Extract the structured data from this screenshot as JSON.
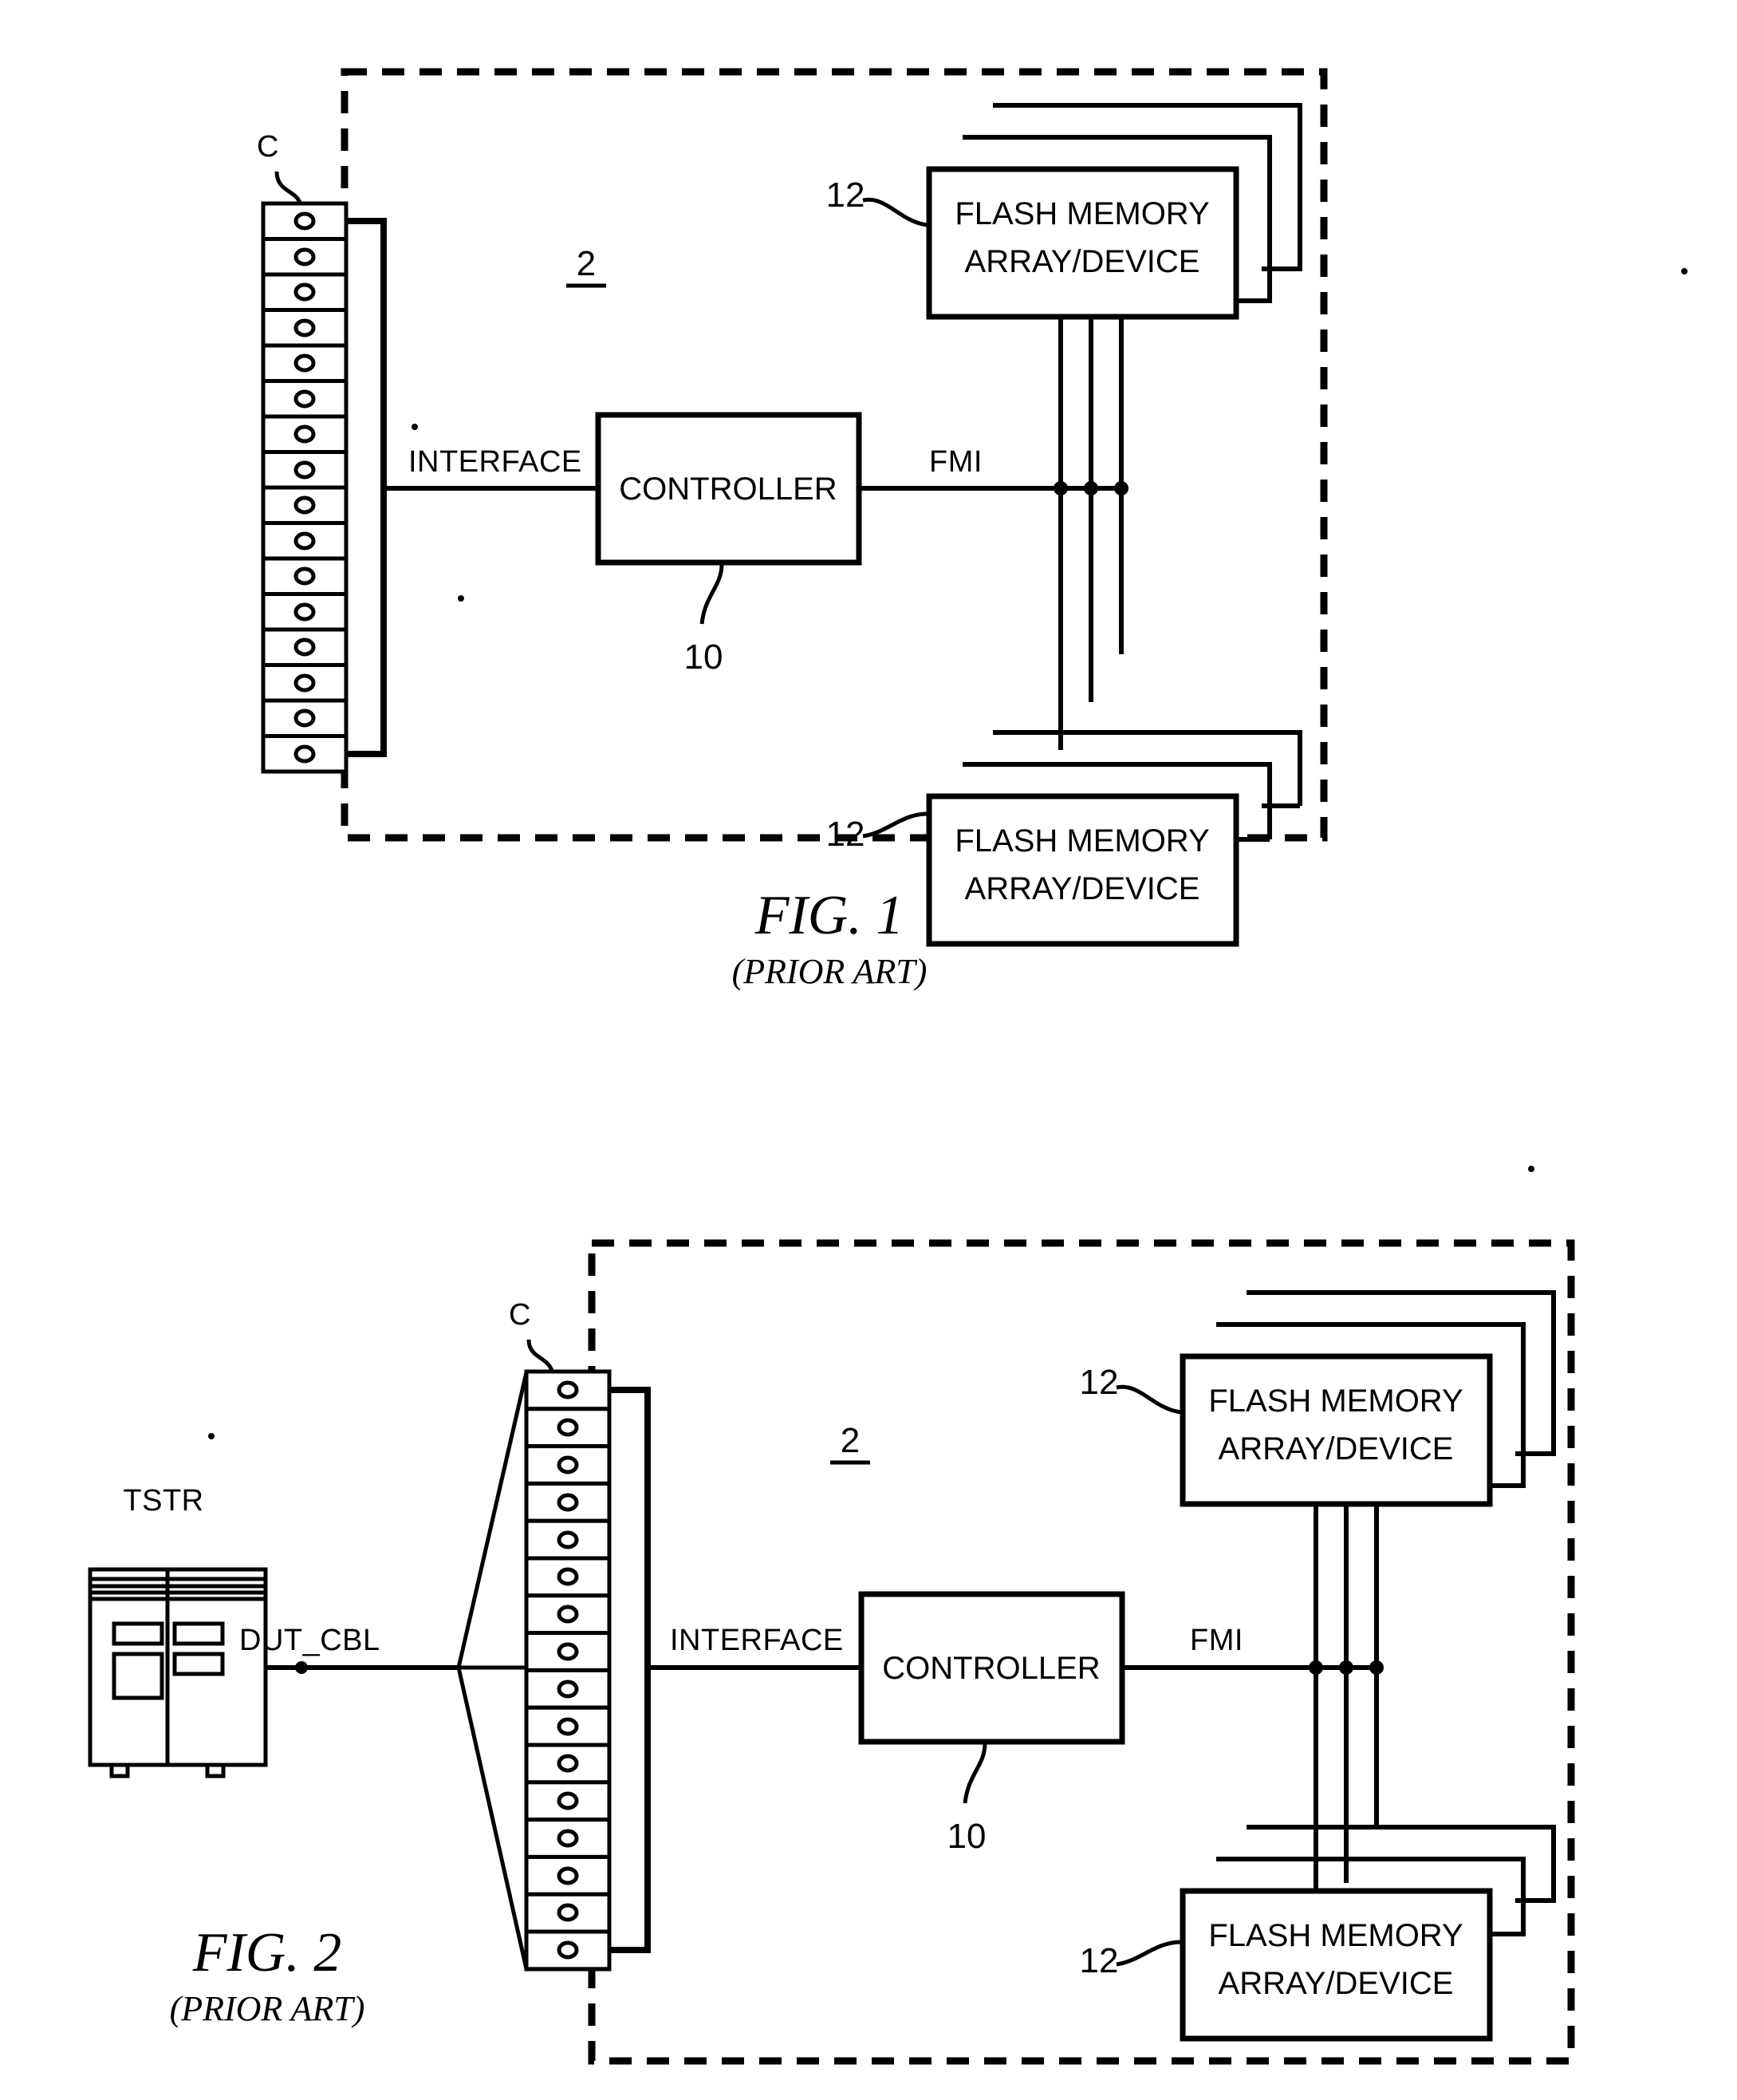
{
  "document": {
    "type": "patent-figure-sheet",
    "figure_count": 2
  },
  "figures": [
    {
      "id": "fig1",
      "title": "FIG. 1",
      "subtitle": "(PRIOR ART)",
      "boundary_label": "2",
      "connector_label": "C",
      "connector_pin_count": 16,
      "interface_label": "INTERFACE",
      "controller_label": "CONTROLLER",
      "controller_ref": "10",
      "fmi_label": "FMI",
      "flash_top": {
        "line1": "FLASH MEMORY",
        "line2": "ARRAY/DEVICE",
        "ref": "12"
      },
      "flash_bottom": {
        "line1": "FLASH MEMORY",
        "line2": "ARRAY/DEVICE",
        "ref": "12"
      }
    },
    {
      "id": "fig2",
      "title": "FIG. 2",
      "subtitle": "(PRIOR ART)",
      "boundary_label": "2",
      "tester_label": "TSTR",
      "cable_label": "DUT_CBL",
      "connector_label": "C",
      "connector_pin_count": 16,
      "interface_label": "INTERFACE",
      "controller_label": "CONTROLLER",
      "controller_ref": "10",
      "fmi_label": "FMI",
      "flash_top": {
        "line1": "FLASH MEMORY",
        "line2": "ARRAY/DEVICE",
        "ref": "12"
      },
      "flash_bottom": {
        "line1": "FLASH MEMORY",
        "line2": "ARRAY/DEVICE",
        "ref": "12"
      }
    }
  ],
  "colors": {
    "ink": "#000000",
    "paper": "#ffffff"
  }
}
